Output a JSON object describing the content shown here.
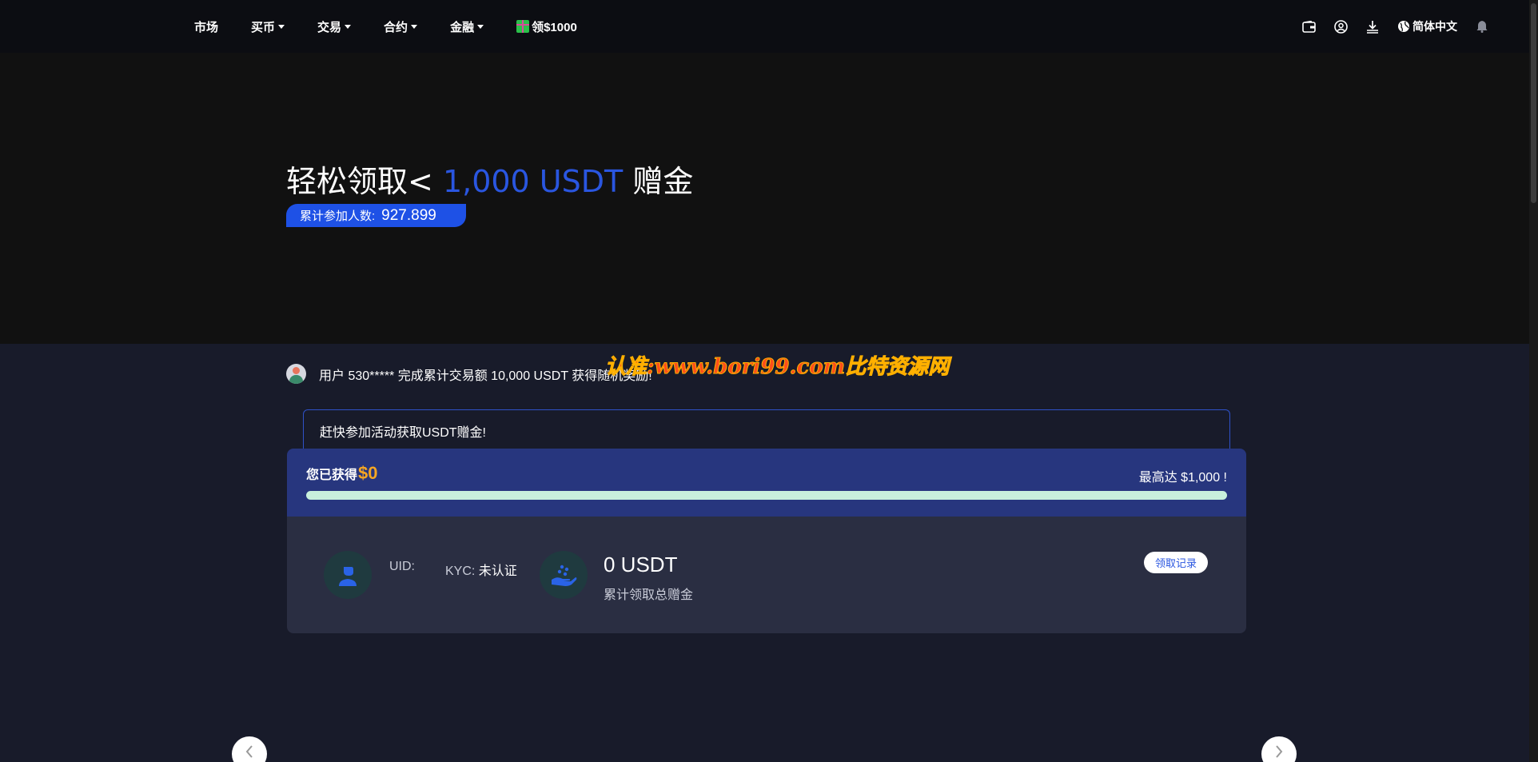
{
  "nav": {
    "items": [
      {
        "label": "市场",
        "has_caret": false
      },
      {
        "label": "买币",
        "has_caret": true
      },
      {
        "label": "交易",
        "has_caret": true
      },
      {
        "label": "合约",
        "has_caret": true
      },
      {
        "label": "金融",
        "has_caret": true
      }
    ],
    "promo_label": "领$1000",
    "language": "简体中文",
    "icons": [
      "wallet-icon",
      "user-icon",
      "download-icon",
      "globe-icon",
      "bell-icon"
    ]
  },
  "hero": {
    "title_prefix": "轻松领取<",
    "title_amount": "1,000 USDT",
    "title_suffix": "赠金",
    "participants_label": "累计参加人数:",
    "participants_count": "927.899"
  },
  "ticker": {
    "message": "用户 530***** 完成累计交易额 10,000 USDT 获得随机奖励!"
  },
  "watermark": "认准:www.bori99.com比特资源网",
  "notice": "赶快参加活动获取USDT赠金!",
  "progress": {
    "earned_label": "您已获得",
    "earned_value": "$0",
    "max_label": "最高达 $1,000 !",
    "fraction": 0
  },
  "info": {
    "uid_label": "UID:",
    "kyc_label": "KYC:",
    "kyc_status": "未认证",
    "total_amount": "0 USDT",
    "total_label": "累计领取总赠金",
    "records_button": "领取记录"
  },
  "colors": {
    "accent": "#1e51e6",
    "highlight": "#2a56e0",
    "earned": "#f5a623",
    "progress_track": "#c8f0dc"
  }
}
